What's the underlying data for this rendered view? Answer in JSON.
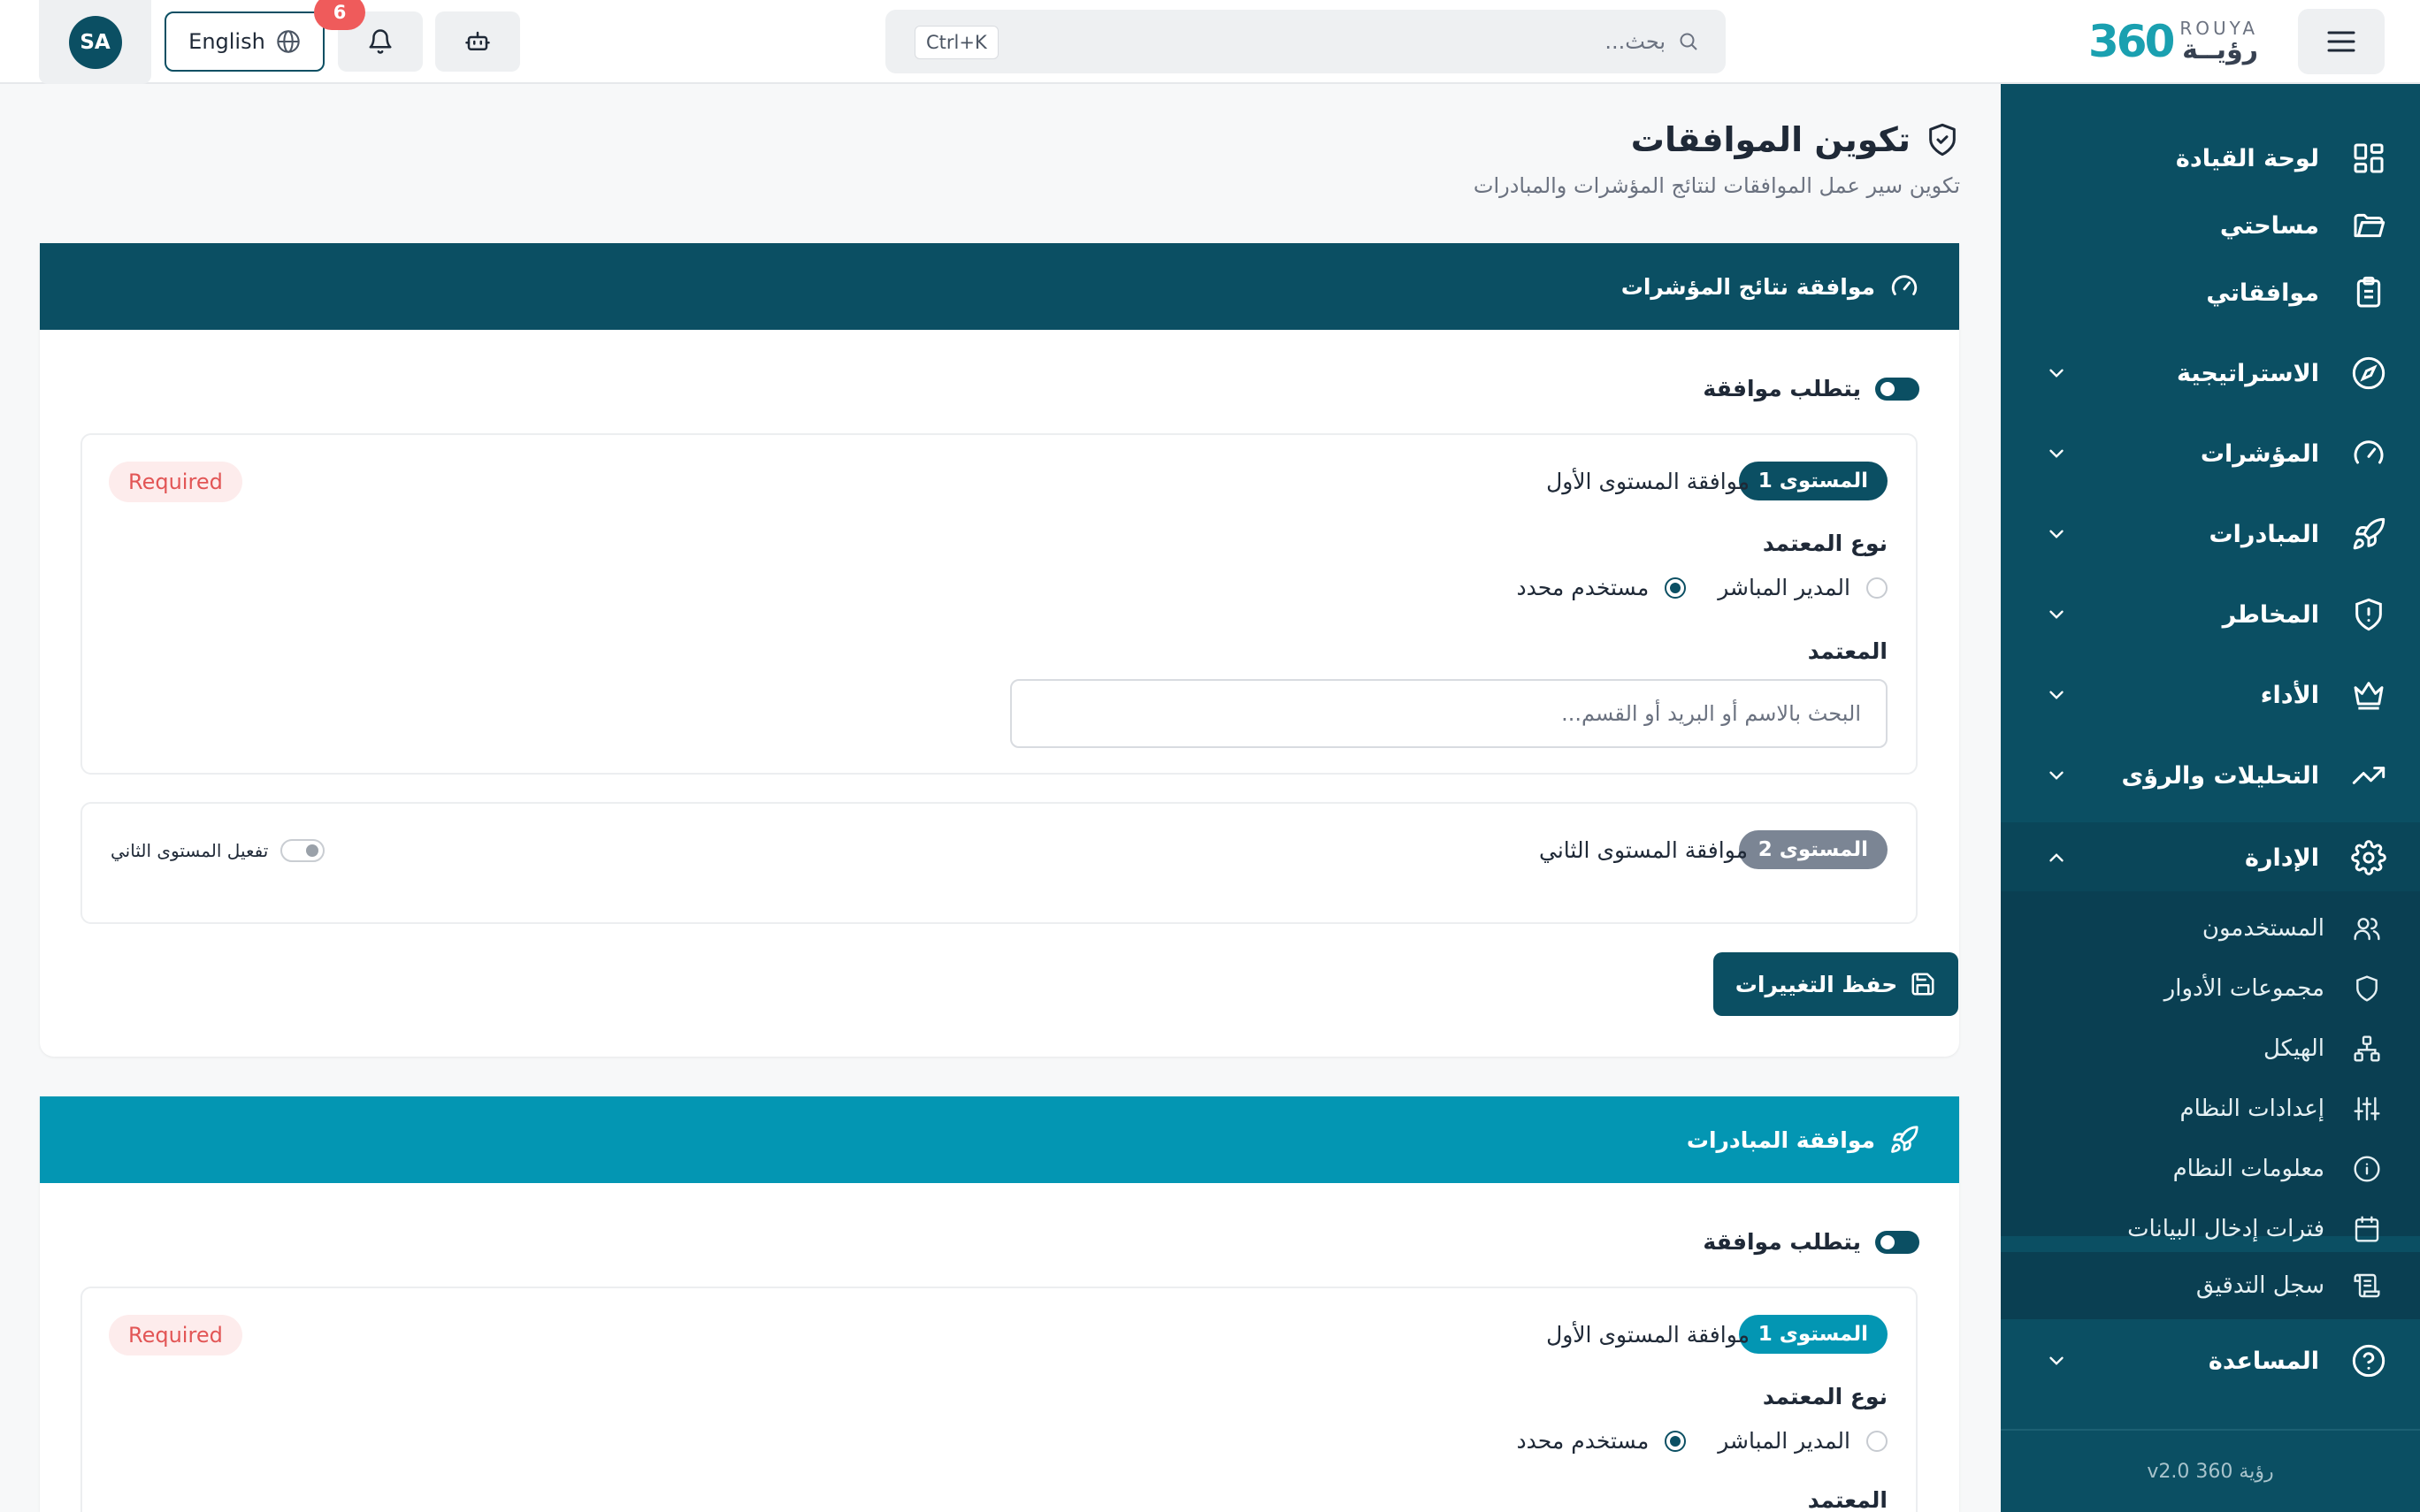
{
  "app": {
    "logo_mark": "360",
    "logo_en": "ROUYA",
    "logo_ar": "رؤيــة"
  },
  "header": {
    "search_placeholder": "بحث...",
    "search_shortcut": "Ctrl+K",
    "notifications_count": "6",
    "language_label": "English",
    "avatar_initials": "SA"
  },
  "sidebar": {
    "items": [
      {
        "label": "لوحة القيادة",
        "icon": "dashboard-icon"
      },
      {
        "label": "مساحتي",
        "icon": "folder-icon"
      },
      {
        "label": "موافقاتي",
        "icon": "clipboard-icon"
      },
      {
        "label": "الاستراتيجية",
        "icon": "compass-icon"
      },
      {
        "label": "المؤشرات",
        "icon": "gauge-icon"
      },
      {
        "label": "المبادرات",
        "icon": "rocket-icon"
      },
      {
        "label": "المخاطر",
        "icon": "shield-alert-icon"
      },
      {
        "label": "الأداء",
        "icon": "crown-icon"
      },
      {
        "label": "التحليلات والرؤى",
        "icon": "trending-up-icon"
      },
      {
        "label": "الإدارة",
        "icon": "gear-icon"
      },
      {
        "label": "المساعدة",
        "icon": "help-circle-icon"
      }
    ],
    "admin_sub": [
      {
        "label": "المستخدمون",
        "icon": "users-icon"
      },
      {
        "label": "مجموعات الأدوار",
        "icon": "shield-icon"
      },
      {
        "label": "الهيكل",
        "icon": "org-chart-icon"
      },
      {
        "label": "إعدادات النظام",
        "icon": "sliders-icon"
      },
      {
        "label": "معلومات النظام",
        "icon": "info-icon"
      },
      {
        "label": "فترات إدخال البيانات",
        "icon": "calendar-icon"
      },
      {
        "label": "سجل التدقيق",
        "icon": "scroll-icon"
      }
    ],
    "version": "رؤية 360 v2.0"
  },
  "page": {
    "title": "تكوين الموافقات",
    "subtitle": "تكوين سير عمل الموافقات لنتائج المؤشرات والمبادرات"
  },
  "kpi_section": {
    "title": "موافقة نتائج المؤشرات",
    "header_color": "#0b4f63",
    "requires_approval_label": "يتطلب موافقة",
    "level1": {
      "badge": "المستوى 1",
      "title": "موافقة المستوى الأول",
      "required": "Required",
      "approver_type_label": "نوع المعتمد",
      "option_manager": "المدير المباشر",
      "option_user": "مستخدم محدد",
      "selected_option": "مستخدم محدد",
      "approver_label": "المعتمد",
      "approver_placeholder": "البحث بالاسم أو البريد أو القسم..."
    },
    "level2": {
      "badge": "المستوى 2",
      "title": "موافقة المستوى الثاني",
      "toggle_label": "تفعيل المستوى الثاني"
    },
    "save_label": "حفظ التغييرات"
  },
  "initiative_section": {
    "title": "موافقة المبادرات",
    "header_color": "#0396b3",
    "requires_approval_label": "يتطلب موافقة",
    "level1": {
      "badge": "المستوى 1",
      "title": "موافقة المستوى الأول",
      "required": "Required",
      "approver_type_label": "نوع المعتمد",
      "option_manager": "المدير المباشر",
      "option_user": "مستخدم محدد",
      "approver_label": "المعتمد"
    }
  }
}
